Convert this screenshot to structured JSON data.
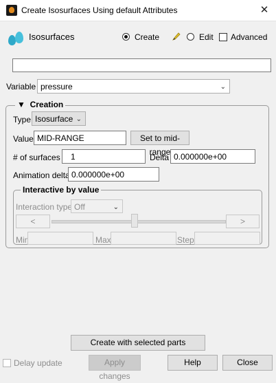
{
  "window": {
    "title": "Create Isosurfaces Using default Attributes",
    "close_glyph": "✕",
    "icon": "app-icon"
  },
  "header": {
    "title": "Isosurfaces",
    "icon": "isosurface-drops-icon",
    "mode": {
      "create_label": "Create",
      "edit_label": "Edit",
      "selected": "Create"
    },
    "advanced_label": "Advanced",
    "advanced_checked": false
  },
  "name_field": {
    "value": ""
  },
  "variable": {
    "label": "Variable",
    "value": "pressure"
  },
  "creation": {
    "label": "Creation",
    "type": {
      "label": "Type",
      "value": "Isosurface"
    },
    "value": {
      "label": "Value",
      "value": "MID-RANGE",
      "set_button": "Set to mid-range"
    },
    "num_surfaces": {
      "label": "# of surfaces",
      "value": "1"
    },
    "delta": {
      "label": "Delta",
      "value": "0.000000e+00"
    },
    "animation_delta": {
      "label": "Animation delta",
      "value": "0.000000e+00"
    },
    "interactive": {
      "label": "Interactive by value",
      "interaction_type": {
        "label": "Interaction type",
        "value": "Off"
      },
      "prev_button": "<",
      "next_button": ">",
      "slider_position": 0.5,
      "min_label": "Min",
      "max_label": "Max",
      "step_label": "Step",
      "min_value": "",
      "max_value": "",
      "step_value": ""
    }
  },
  "footer": {
    "create_button": "Create with selected parts",
    "delay_update_label": "Delay update",
    "delay_update_checked": false,
    "apply_button": "Apply changes",
    "help_button": "Help",
    "close_button": "Close"
  },
  "colors": {
    "background": "#f0f0f0",
    "accent_drops": "#2fa9c9",
    "pencil": "#e3c22f"
  }
}
